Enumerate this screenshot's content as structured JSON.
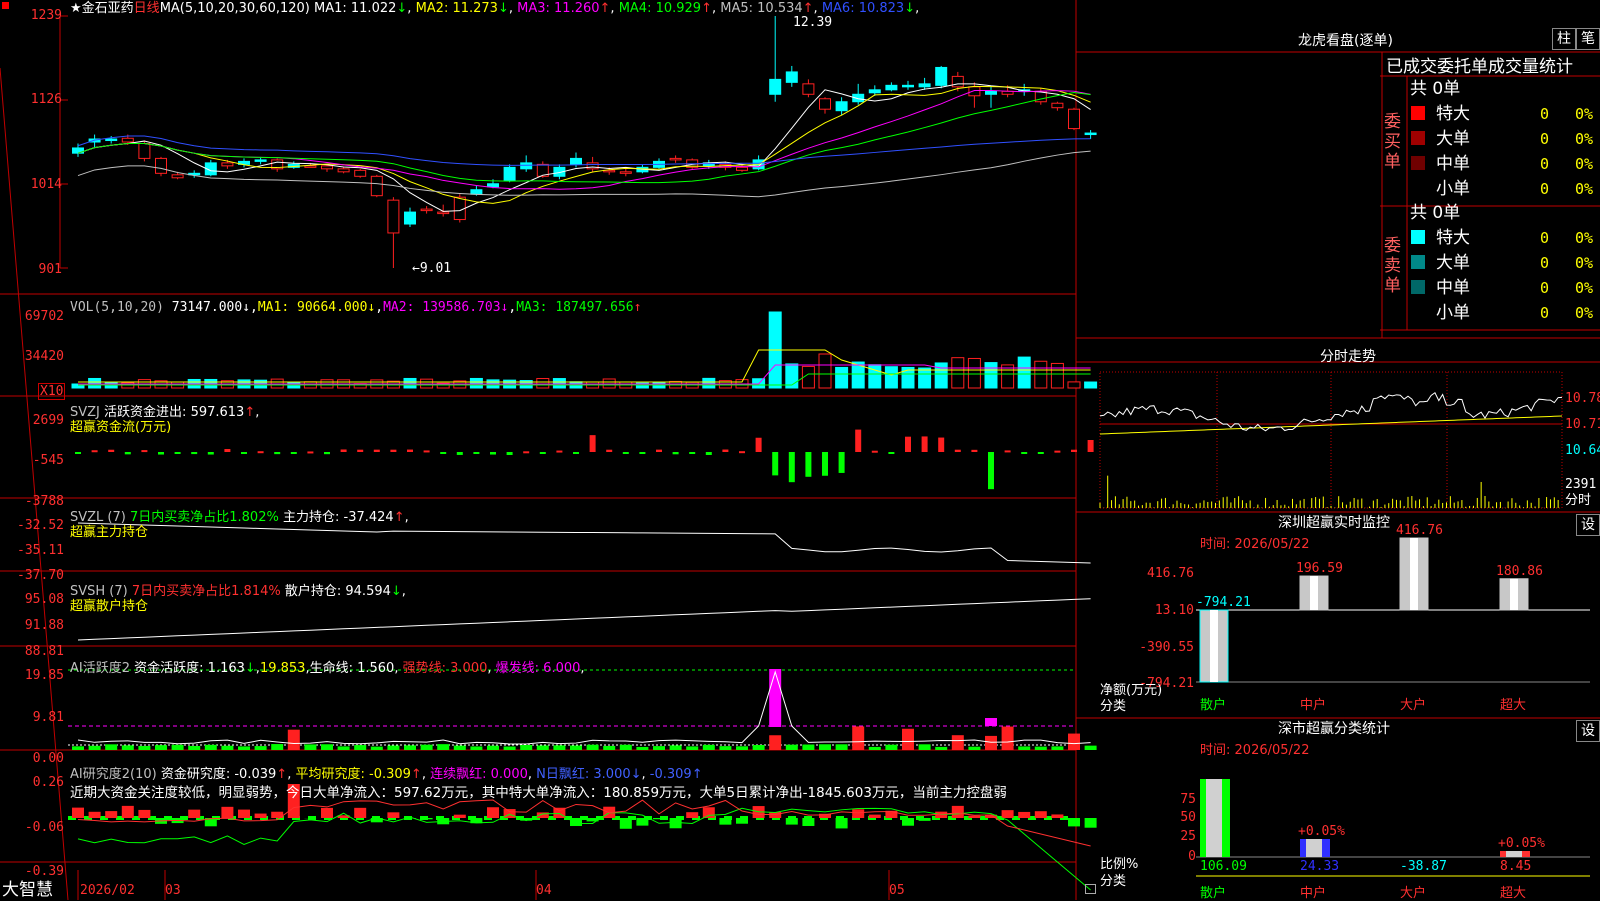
{
  "header": {
    "star": "★",
    "stock": "金石亚药",
    "period": "日线",
    "ma_label": "MA(5,10,20,30,60,120)",
    "ma": [
      {
        "name": "MA1:",
        "val": "11.022",
        "arr": "↓",
        "color": "#ffffff"
      },
      {
        "name": "MA2:",
        "val": "11.273",
        "arr": "↓",
        "color": "#ffff00"
      },
      {
        "name": "MA3:",
        "val": "11.260",
        "arr": "↑",
        "color": "#ff00ff"
      },
      {
        "name": "MA4:",
        "val": "10.929",
        "arr": "↑",
        "color": "#00ff00"
      },
      {
        "name": "MA5:",
        "val": "10.534",
        "arr": "↑",
        "color": "#c0c0c0"
      },
      {
        "name": "MA6:",
        "val": "10.823",
        "arr": "↓",
        "color": "#3050ff"
      }
    ]
  },
  "price_axis": [
    "1239",
    "1126",
    "1014",
    "901"
  ],
  "annotations": {
    "high": "12.39",
    "low": "←9.01"
  },
  "vol": {
    "label": "VOL(5,10,20)",
    "val": "73147.000",
    "arr": "↓",
    "ma1": "MA1:",
    "ma1v": "90664.000",
    "ma1a": "↓",
    "ma2": "MA2:",
    "ma2v": "139586.703",
    "ma2a": "↓",
    "ma3": "MA3:",
    "ma3v": "187497.656",
    "ma3a": "↑",
    "axis": [
      "69702",
      "34420"
    ],
    "unit": "X10"
  },
  "svzj": {
    "name": "SVZJ",
    "l1": "活跃资金进出:",
    "v1": "597.613",
    "a1": "↑",
    "sub": "超赢资金流(万元)",
    "axis": [
      "2699",
      "-545",
      "-3788"
    ]
  },
  "svzl": {
    "name": "SVZL (7)",
    "l1": "7日内买卖净占比1.802%",
    "l2": "主力持仓:",
    "v2": "-37.424",
    "a2": "↑",
    "sub": "超赢主力持仓",
    "axis": [
      "-32.52",
      "-35.11",
      "-37.70"
    ]
  },
  "svsh": {
    "name": "SVSH (7)",
    "l1": "7日内买卖净占比1.814%",
    "l2": "散户持仓:",
    "v2": "94.594",
    "a2": "↓",
    "sub": "超赢散户持仓",
    "axis": [
      "95.08",
      "91.88",
      "88.81"
    ]
  },
  "ai1": {
    "name": "AI活跃度2",
    "l1": "资金活跃度:",
    "v1": "1.163",
    "a1": "↓",
    "v2": "19.853",
    "l3": "生命线:",
    "v3": "1.560",
    "l4": "强势线:",
    "v4": "3.000",
    "l5": "爆发线:",
    "v5": "6.000",
    "axis": [
      "19.85",
      "9.81",
      "0.00"
    ]
  },
  "ai2": {
    "name": "AI研究度2(10)",
    "l1": "资金研究度:",
    "v1": "-0.039",
    "a1": "↑",
    "l2": "平均研究度:",
    "v2": "-0.309",
    "a2": "↑",
    "l3": "连续飘红:",
    "v3": "0.000",
    "l4": "N日飘红:",
    "v4": "3.000",
    "a4": "↓",
    "v5": "-0.309",
    "a5": "↑",
    "text": "近期大资金关注度较低，明显弱势，今日大单净流入：597.62万元，其中特大单净流入：180.859万元，大单5日累计净出-1845.603万元，当前主力控盘弱",
    "axis": [
      "0.26",
      "-0.06",
      "-0.39"
    ]
  },
  "bottom": {
    "brand": "大智慧",
    "dates": [
      "2026/02",
      "03",
      "04",
      "05"
    ]
  },
  "dragon": {
    "title": "龙虎看盘(逐单)",
    "btn1": "柱",
    "btn2": "笔",
    "tabs": [
      "已成交",
      "委托单",
      "成交量统计"
    ],
    "buy": {
      "side": "委买单",
      "total": "共 0单",
      "rows": [
        {
          "label": "特大",
          "v": "0",
          "p": "0%",
          "color": "#ff0000"
        },
        {
          "label": "大单",
          "v": "0",
          "p": "0%",
          "color": "#a00000"
        },
        {
          "label": "中单",
          "v": "0",
          "p": "0%",
          "color": "#700000"
        },
        {
          "label": "小单",
          "v": "0",
          "p": "0%",
          "color": ""
        }
      ]
    },
    "sell": {
      "side": "委卖单",
      "total": "共 0单",
      "rows": [
        {
          "label": "特大",
          "v": "0",
          "p": "0%",
          "color": "#00ffff"
        },
        {
          "label": "大单",
          "v": "0",
          "p": "0%",
          "color": "#008888"
        },
        {
          "label": "中单",
          "v": "0",
          "p": "0%",
          "color": "#006868"
        },
        {
          "label": "小单",
          "v": "0",
          "p": "0%",
          "color": ""
        }
      ]
    }
  },
  "intraday": {
    "title": "分时走势",
    "axis": [
      "10.78",
      "10.71",
      "10.64"
    ],
    "vol": "2391",
    "vol_label": "分时"
  },
  "sz_monitor": {
    "title": "深圳超赢实时监控",
    "btn": "设",
    "time_label": "时间:",
    "time": "2026/05/22",
    "axis": [
      "416.76",
      "13.10",
      "-390.55",
      "-794.21"
    ],
    "ylabel": "净额(万元)",
    "xlabel": "分类",
    "bars": [
      {
        "cat": "散户",
        "val": -794.21,
        "label": "-794.21"
      },
      {
        "cat": "中户",
        "val": 196.59,
        "label": "196.59"
      },
      {
        "cat": "大户",
        "val": 416.76,
        "label": "416.76"
      },
      {
        "cat": "超大",
        "val": 180.86,
        "label": "180.86"
      }
    ]
  },
  "sz_stats": {
    "title": "深市超赢分类统计",
    "btn": "设",
    "time_label": "时间:",
    "time": "2026/05/22",
    "axis": [
      "75",
      "50",
      "25",
      "0"
    ],
    "ylabel": "比例%",
    "xlabel": "分类",
    "bars": [
      {
        "cat": "散户",
        "label": "106.09"
      },
      {
        "cat": "中户",
        "label": "24.33",
        "top": "+0.05%"
      },
      {
        "cat": "大户",
        "label": "-38.87"
      },
      {
        "cat": "超大",
        "label": "8.45",
        "top": "+0.05%"
      }
    ]
  },
  "chart_data": {
    "type": "candlestick",
    "title": "金石亚药 日线",
    "high_annotation": 12.39,
    "low_annotation": 9.01,
    "candles": [
      [
        10.62,
        10.55,
        10.68,
        10.5
      ],
      [
        10.74,
        10.7,
        10.8,
        10.62
      ],
      [
        10.74,
        10.72,
        10.78,
        10.68
      ],
      [
        10.7,
        10.75,
        10.8,
        10.66
      ],
      [
        10.48,
        10.68,
        10.72,
        10.44
      ],
      [
        10.28,
        10.48,
        10.5,
        10.24
      ],
      [
        10.22,
        10.26,
        10.3,
        10.2
      ],
      [
        10.28,
        10.26,
        10.32,
        10.22
      ],
      [
        10.42,
        10.26,
        10.46,
        10.24
      ],
      [
        10.38,
        10.42,
        10.46,
        10.34
      ],
      [
        10.44,
        10.4,
        10.48,
        10.36
      ],
      [
        10.46,
        10.44,
        10.5,
        10.4
      ],
      [
        10.34,
        10.46,
        10.48,
        10.3
      ],
      [
        10.4,
        10.36,
        10.44,
        10.34
      ],
      [
        10.38,
        10.38,
        10.42,
        10.36
      ],
      [
        10.34,
        10.38,
        10.4,
        10.3
      ],
      [
        10.3,
        10.34,
        10.36,
        10.28
      ],
      [
        10.24,
        10.32,
        10.34,
        10.22
      ],
      [
        9.98,
        10.24,
        10.26,
        9.96
      ],
      [
        9.48,
        9.92,
        9.96,
        9.01
      ],
      [
        9.76,
        9.6,
        9.82,
        9.56
      ],
      [
        9.78,
        9.8,
        9.84,
        9.74
      ],
      [
        9.74,
        9.76,
        9.86,
        9.7
      ],
      [
        9.66,
        9.96,
        10.0,
        9.62
      ],
      [
        10.06,
        10.0,
        10.12,
        9.98
      ],
      [
        10.14,
        10.1,
        10.2,
        10.08
      ],
      [
        10.36,
        10.18,
        10.4,
        10.16
      ],
      [
        10.42,
        10.34,
        10.52,
        10.3
      ],
      [
        10.24,
        10.4,
        10.44,
        10.22
      ],
      [
        10.36,
        10.24,
        10.4,
        10.2
      ],
      [
        10.48,
        10.4,
        10.56,
        10.36
      ],
      [
        10.34,
        10.42,
        10.5,
        10.3
      ],
      [
        10.3,
        10.32,
        10.36,
        10.26
      ],
      [
        10.28,
        10.3,
        10.34,
        10.24
      ],
      [
        10.36,
        10.3,
        10.4,
        10.28
      ],
      [
        10.44,
        10.36,
        10.48,
        10.34
      ],
      [
        10.46,
        10.48,
        10.52,
        10.42
      ],
      [
        10.36,
        10.46,
        10.48,
        10.34
      ],
      [
        10.42,
        10.38,
        10.46,
        10.34
      ],
      [
        10.36,
        10.4,
        10.44,
        10.32
      ],
      [
        10.32,
        10.36,
        10.4,
        10.3
      ],
      [
        10.46,
        10.34,
        10.52,
        10.32
      ],
      [
        11.54,
        11.34,
        12.39,
        11.24
      ],
      [
        11.64,
        11.5,
        11.72,
        11.44
      ],
      [
        11.34,
        11.48,
        11.54,
        11.3
      ],
      [
        11.14,
        11.28,
        11.3,
        11.08
      ],
      [
        11.24,
        11.12,
        11.3,
        11.06
      ],
      [
        11.34,
        11.24,
        11.48,
        11.2
      ],
      [
        11.4,
        11.36,
        11.46,
        11.32
      ],
      [
        11.46,
        11.4,
        11.5,
        11.38
      ],
      [
        11.46,
        11.44,
        11.52,
        11.4
      ],
      [
        11.48,
        11.44,
        11.56,
        11.4
      ],
      [
        11.7,
        11.46,
        11.72,
        11.42
      ],
      [
        11.44,
        11.58,
        11.64,
        11.38
      ],
      [
        11.32,
        11.44,
        11.5,
        11.16
      ],
      [
        11.38,
        11.34,
        11.46,
        11.16
      ],
      [
        11.34,
        11.38,
        11.46,
        11.3
      ],
      [
        11.4,
        11.38,
        11.48,
        11.32
      ],
      [
        11.24,
        11.38,
        11.42,
        11.2
      ],
      [
        11.16,
        11.22,
        11.24,
        11.12
      ],
      [
        10.88,
        11.14,
        11.16,
        10.86
      ],
      [
        10.82,
        10.8,
        10.86,
        10.74
      ]
    ]
  }
}
